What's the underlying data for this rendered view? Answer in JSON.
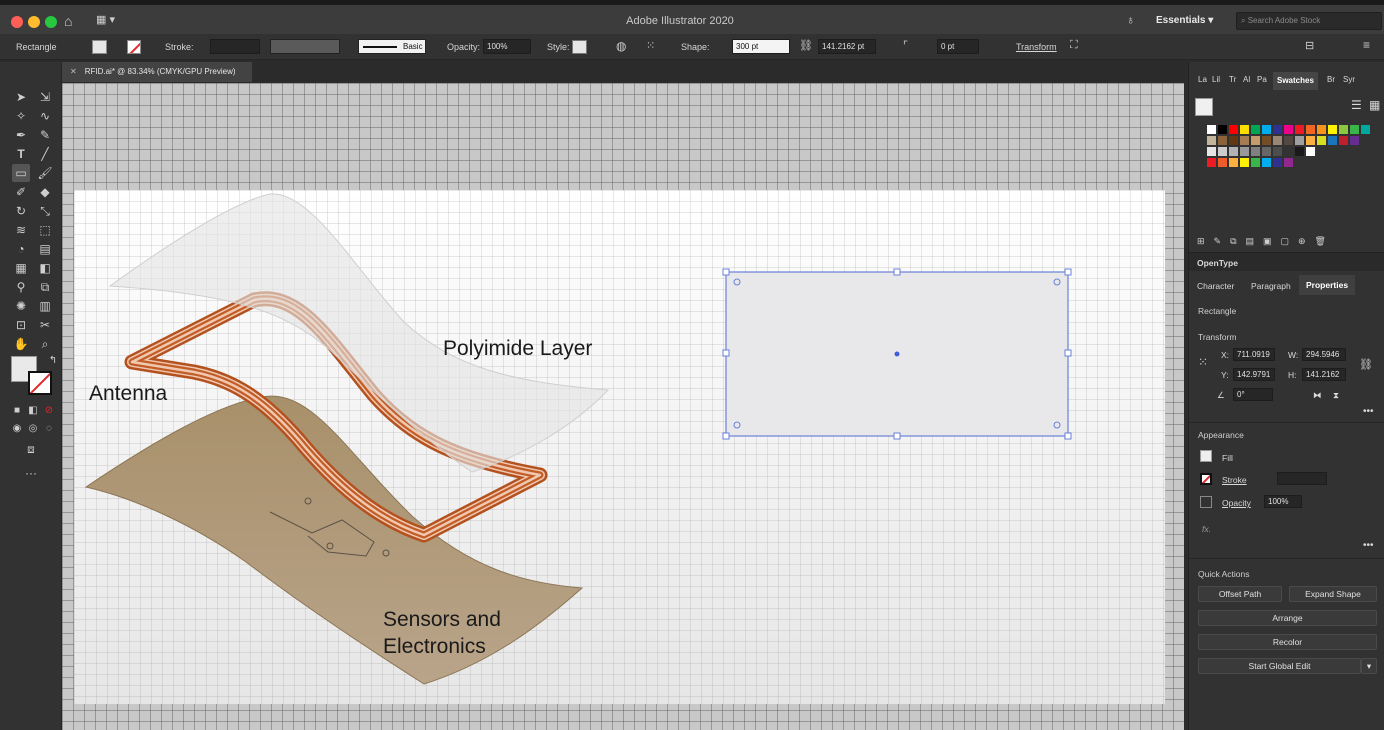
{
  "app": {
    "title": "Adobe Illustrator 2020",
    "workspace": "Essentials",
    "search_placeholder": "Search Adobe Stock"
  },
  "control": {
    "selection": "Rectangle",
    "stroke_label": "Stroke:",
    "brush": "Basic",
    "opacity_label": "Opacity:",
    "opacity": "100%",
    "style_label": "Style:",
    "shape_label": "Shape:",
    "width": "300 pt",
    "height": "141.2162 pt",
    "corner": "0 pt",
    "transform": "Transform"
  },
  "document": {
    "tab": "RFID.ai* @ 83.34% (CMYK/GPU Preview)"
  },
  "artwork": {
    "polyimide": "Polyimide Layer",
    "antenna": "Antenna",
    "sensors_1": "Sensors and",
    "sensors_2": "Electronics"
  },
  "panels": {
    "top_tabs": [
      "La",
      "Lil",
      "Tr",
      "Al",
      "Pa",
      "Swatches",
      "Br",
      "Syr"
    ],
    "mid_tab": "OpenType",
    "tabs": [
      "Character",
      "Paragraph",
      "Properties"
    ]
  },
  "swatches": {
    "row1": [
      "#ffffff",
      "#000000",
      "#ff0000",
      "#ffde00",
      "#00a651",
      "#00aeef",
      "#2e3192",
      "#ec008c",
      "#ed1c24",
      "#f26522",
      "#f7941d",
      "#fff200",
      "#8dc63f",
      "#39b54a",
      "#00a99d"
    ],
    "row2": [
      "#c2b59b",
      "#8c6239",
      "#603913",
      "#a67c52",
      "#c69c6d",
      "#754c24",
      "#998675",
      "#534741",
      "#a0a0a0",
      "#fbb040",
      "#d7df23",
      "#1c75bc",
      "#be1e2d",
      "#662d91"
    ],
    "row3": [
      "#e5e5e5",
      "#cccccc",
      "#b3b3b3",
      "#999999",
      "#808080",
      "#666666",
      "#4d4d4d",
      "#333333",
      "#1a1a1a",
      "#ffffff"
    ],
    "row4": [
      "#ed1c24",
      "#f15a29",
      "#fbb040",
      "#fff200",
      "#39b54a",
      "#00aeef",
      "#2e3192",
      "#92278f"
    ]
  },
  "properties": {
    "object": "Rectangle",
    "transform_label": "Transform",
    "x": "711.0919",
    "y": "142.9791",
    "w": "294.5946",
    "h": "141.2162",
    "angle": "0°",
    "appearance_label": "Appearance",
    "fill": "Fill",
    "stroke": "Stroke",
    "opacity_label": "Opacity",
    "opacity": "100%",
    "fx": "fx.",
    "quick_actions": "Quick Actions",
    "btn_offset": "Offset Path",
    "btn_expand": "Expand Shape",
    "btn_arrange": "Arrange",
    "btn_recolor": "Recolor",
    "btn_global": "Start Global Edit"
  }
}
